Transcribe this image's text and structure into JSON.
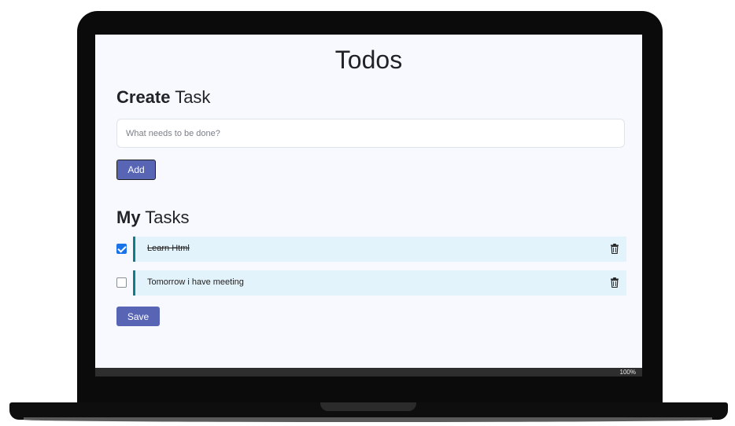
{
  "app": {
    "title": "Todos"
  },
  "create": {
    "heading_bold": "Create",
    "heading_rest": " Task",
    "input_placeholder": "What needs to be done?",
    "input_value": "",
    "add_label": "Add"
  },
  "tasks": {
    "heading_bold": "My",
    "heading_rest": " Tasks",
    "items": [
      {
        "text": "Learn Html",
        "done": true
      },
      {
        "text": "Tomorrow i have meeting",
        "done": false
      }
    ],
    "save_label": "Save"
  },
  "statusbar": {
    "zoom": "100%"
  },
  "icons": {
    "delete": "trash-icon",
    "check": "checkbox"
  },
  "colors": {
    "accent": "#5865b5",
    "task_card_bg": "#e3f3fb",
    "task_border": "#0f7d8c",
    "checkbox_checked": "#1a73e8"
  }
}
